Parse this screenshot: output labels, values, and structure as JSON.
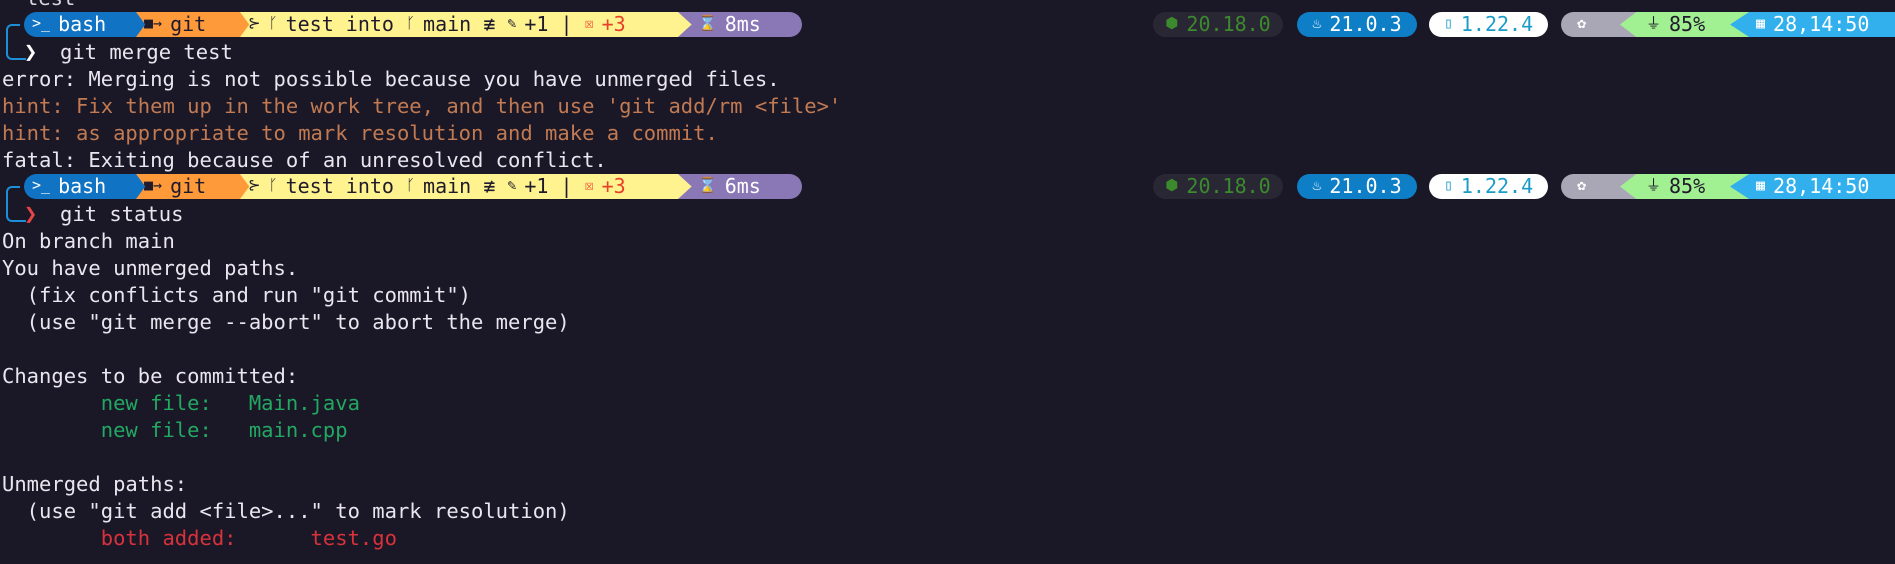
{
  "top_cut_text": "test",
  "prompt1": {
    "shell_label": "bash",
    "dir_label": "git",
    "branch_text": "test into",
    "branch_main": "main",
    "branch_state": "≢",
    "staged": "+1",
    "sep": "|",
    "conflicts": "+3",
    "duration": "8ms",
    "node": "20.18.0",
    "java": "21.0.3",
    "go": "1.22.4",
    "battery": "85%",
    "date": "28,14:50",
    "command": "git merge test"
  },
  "output1": {
    "error": "error: Merging is not possible because you have unmerged files.",
    "hint1": "hint: Fix them up in the work tree, and then use 'git add/rm <file>'",
    "hint2": "hint: as appropriate to mark resolution and make a commit.",
    "fatal": "fatal: Exiting because of an unresolved conflict."
  },
  "prompt2": {
    "shell_label": "bash",
    "dir_label": "git",
    "branch_text": "test into",
    "branch_main": "main",
    "branch_state": "≢",
    "staged": "+1",
    "sep": "|",
    "conflicts": "+3",
    "duration": "6ms",
    "node": "20.18.0",
    "java": "21.0.3",
    "go": "1.22.4",
    "battery": "85%",
    "date": "28,14:50",
    "command": "git status"
  },
  "output2": {
    "on_branch": "On branch main",
    "unmerged": "You have unmerged paths.",
    "fix_hint": "  (fix conflicts and run \"git commit\")",
    "abort_hint": "  (use \"git merge --abort\" to abort the merge)",
    "changes_header": "Changes to be committed:",
    "new_file_1": "        new file:   Main.java",
    "new_file_2": "        new file:   main.cpp",
    "unmerged_header": "Unmerged paths:",
    "add_hint": "  (use \"git add <file>...\" to mark resolution)",
    "both_added": "        both added:      test.go"
  },
  "colors": {
    "background": "#1a1726",
    "bash_segment": "#1073c3",
    "git_segment": "#ff9a3a",
    "branch_segment": "#fff38f",
    "time_segment": "#8a78b6",
    "java_segment": "#0e7fc6",
    "battery_segment": "#a1f091",
    "date_segment": "#32b0ee",
    "error_prompt": "#e84545"
  }
}
